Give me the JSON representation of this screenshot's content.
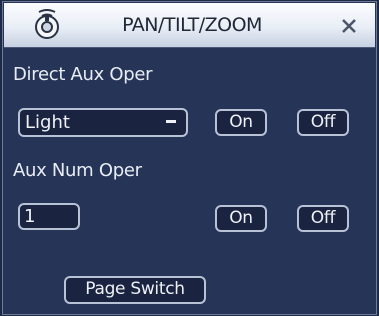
{
  "window": {
    "title": "PAN/TILT/ZOOM",
    "app_icon": "ptz-camera-icon",
    "close_icon": "close-icon"
  },
  "direct_aux": {
    "label": "Direct Aux Oper",
    "select_value": "Light",
    "on_label": "On",
    "off_label": "Off"
  },
  "aux_num": {
    "label": "Aux Num Oper",
    "input_value": "1",
    "on_label": "On",
    "off_label": "Off"
  },
  "page_switch_label": "Page Switch"
}
